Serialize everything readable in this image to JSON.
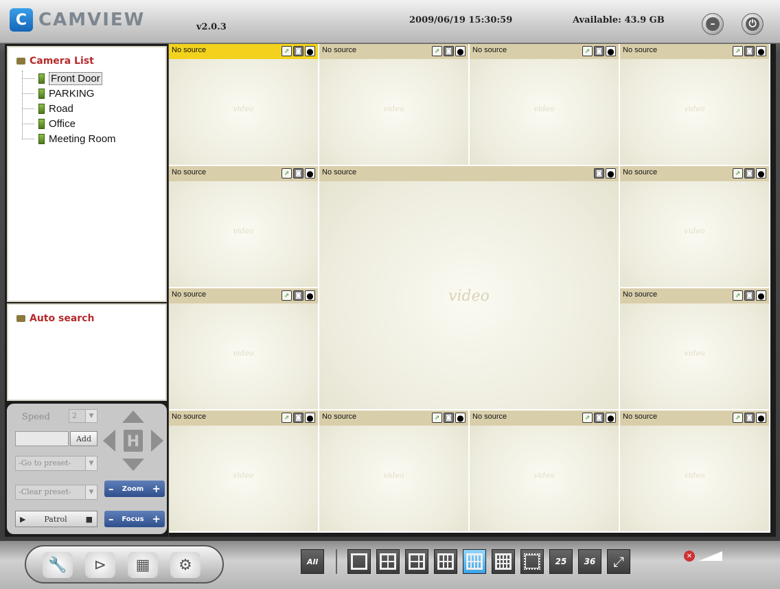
{
  "header": {
    "brand": "CAMVIEW",
    "version": "v2.0.3",
    "datetime": "2009/06/19 15:30:59",
    "available": "Available: 43.9 GB"
  },
  "camera_list": {
    "title": "Camera List",
    "items": [
      {
        "label": "Front Door",
        "selected": true
      },
      {
        "label": "PARKING",
        "selected": false
      },
      {
        "label": "Road",
        "selected": false
      },
      {
        "label": "Office",
        "selected": false
      },
      {
        "label": "Meeting Room",
        "selected": false
      }
    ]
  },
  "auto_search": {
    "title": "Auto search"
  },
  "ptz": {
    "speed_label": "Speed",
    "speed_value": "2",
    "add_label": "Add",
    "goto_preset": "-Go to preset-",
    "clear_preset": "-Clear preset-",
    "patrol_label": "Patrol",
    "zoom_label": "Zoom",
    "focus_label": "Focus"
  },
  "grid": {
    "no_source": "No source",
    "watermark": "video"
  },
  "colors": {
    "active_bar": "#f2d21c",
    "bar": "#d9ceaa",
    "accent_blue": "#3aa4e8",
    "title_red": "#b52a2a"
  },
  "toolbar": {
    "all_label": "All",
    "num25": "25",
    "num36": "36"
  }
}
